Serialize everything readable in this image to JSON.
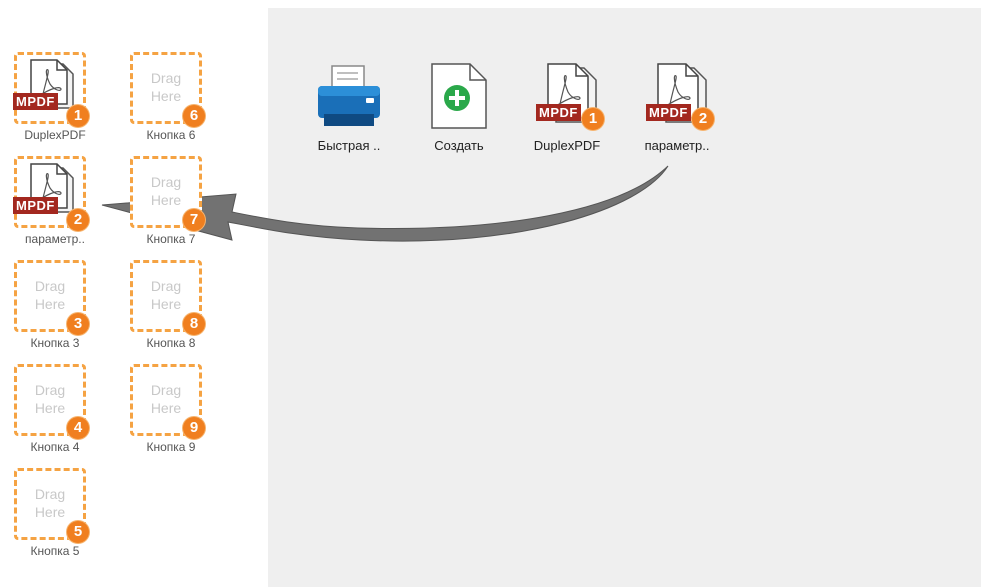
{
  "slots": [
    {
      "id": 1,
      "label": "DuplexPDF",
      "filled": true,
      "tag": "MPDF",
      "number": "1"
    },
    {
      "id": 2,
      "label": "параметр..",
      "filled": true,
      "tag": "MPDF",
      "number": "2"
    },
    {
      "id": 3,
      "label": "Кнопка 3",
      "filled": false,
      "drag_line1": "Drag",
      "drag_line2": "Here",
      "number": "3"
    },
    {
      "id": 4,
      "label": "Кнопка 4",
      "filled": false,
      "drag_line1": "Drag",
      "drag_line2": "Here",
      "number": "4"
    },
    {
      "id": 5,
      "label": "Кнопка 5",
      "filled": false,
      "drag_line1": "Drag",
      "drag_line2": "Here",
      "number": "5"
    },
    {
      "id": 6,
      "label": "Кнопка 6",
      "filled": false,
      "drag_line1": "Drag",
      "drag_line2": "Here",
      "number": "6"
    },
    {
      "id": 7,
      "label": "Кнопка 7",
      "filled": false,
      "drag_line1": "Drag",
      "drag_line2": "Here",
      "number": "7"
    },
    {
      "id": 8,
      "label": "Кнопка 8",
      "filled": false,
      "drag_line1": "Drag",
      "drag_line2": "Here",
      "number": "8"
    },
    {
      "id": 9,
      "label": "Кнопка 9",
      "filled": false,
      "drag_line1": "Drag",
      "drag_line2": "Here",
      "number": "9"
    }
  ],
  "apps": [
    {
      "label": "Быстрая ..",
      "icon": "scanner-printer-icon"
    },
    {
      "label": "Создать",
      "icon": "new-document-icon"
    },
    {
      "label": "DuplexPDF",
      "icon": "pdf-document-icon",
      "tag": "MPDF",
      "number": "1"
    },
    {
      "label": "параметр..",
      "icon": "pdf-document-icon",
      "tag": "MPDF",
      "number": "2"
    }
  ],
  "colors": {
    "accent_orange": "#f07f1f",
    "dashed_border": "#f5a343",
    "mpdf_red": "#a3281f",
    "create_green": "#2aa84a",
    "scanner_blue": "#1a6fb8",
    "panel_bg": "#efefef",
    "arrow_gray": "#707070"
  }
}
